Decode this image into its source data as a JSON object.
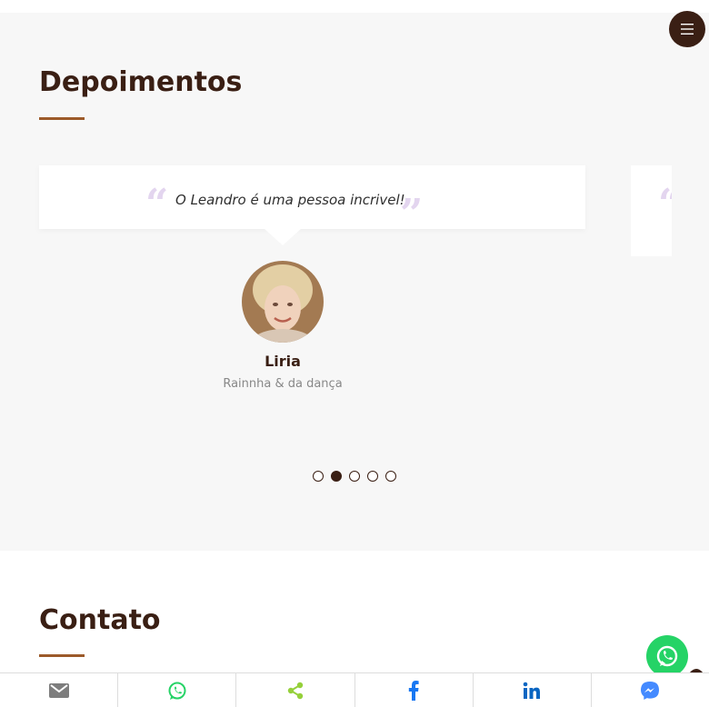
{
  "testimonials": {
    "title": "Depoimentos",
    "quote": "O Leandro é uma pessoa incrivel!",
    "name": "Liria",
    "role": "Rainnha & da dança",
    "pagination": {
      "total": 5,
      "active_index": 1
    }
  },
  "contact": {
    "title": "Contato"
  },
  "icons": {
    "menu": "hamburger-menu-icon",
    "quote_open": "quote-open-icon",
    "quote_close": "quote-close-icon",
    "whatsapp": "whatsapp-icon",
    "scroll_top": "chevron-up-icon",
    "share": [
      "email-icon",
      "whatsapp-icon",
      "sharethis-icon",
      "facebook-icon",
      "linkedin-icon",
      "messenger-icon"
    ]
  },
  "colors": {
    "brand_dark": "#3a1f14",
    "accent": "#9c5a2a",
    "quote_marks": "#e3d5ef",
    "whatsapp": "#25d366",
    "email": "#7d7d7d",
    "sharethis": "#95d03a",
    "facebook": "#1877f2",
    "linkedin": "#0a66c2",
    "messenger": "#448aff"
  }
}
